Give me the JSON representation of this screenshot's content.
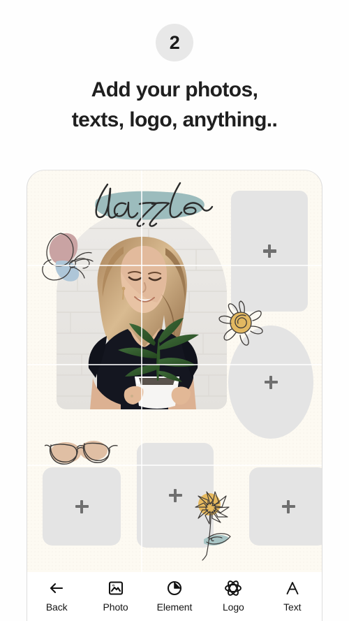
{
  "header": {
    "step_number": "2",
    "headline_line1": "Add your photos,",
    "headline_line2": "texts, logo, anything.."
  },
  "canvas": {
    "background_color": "#fdfaf2",
    "placeholder_color": "#e4e4e4",
    "plus_label": "+",
    "photo": {
      "description": "woman holding potted plant",
      "shape": "arch"
    },
    "placeholders": [
      {
        "id": "top-right",
        "shape": "rounded-rect",
        "plus": "+"
      },
      {
        "id": "middle-right",
        "shape": "oval",
        "plus": "+"
      },
      {
        "id": "bottom-left",
        "shape": "rounded-rect",
        "plus": "+"
      },
      {
        "id": "bottom-center",
        "shape": "rounded-rect",
        "plus": "+"
      },
      {
        "id": "bottom-right",
        "shape": "rounded-rect",
        "plus": "+"
      }
    ],
    "stickers": [
      {
        "id": "dazzle-text",
        "type": "script-text",
        "text": "dazzle",
        "highlight_color": "#9cbcbd",
        "text_color": "#2b2b2b"
      },
      {
        "id": "butterfly",
        "type": "doodle",
        "colors": [
          "#c9a3a3",
          "#aec6d8"
        ]
      },
      {
        "id": "sun",
        "type": "doodle",
        "colors": [
          "#e2b861"
        ]
      },
      {
        "id": "glasses",
        "type": "doodle",
        "colors": [
          "#e0bfa4"
        ]
      },
      {
        "id": "flower",
        "type": "doodle",
        "colors": [
          "#e6b95e",
          "#a8c5c5"
        ]
      }
    ]
  },
  "nav": {
    "items": [
      {
        "label": "Back",
        "icon": "back-arrow-icon"
      },
      {
        "label": "Photo",
        "icon": "photo-icon"
      },
      {
        "label": "Element",
        "icon": "element-icon"
      },
      {
        "label": "Logo",
        "icon": "logo-icon"
      },
      {
        "label": "Text",
        "icon": "text-icon"
      }
    ]
  }
}
